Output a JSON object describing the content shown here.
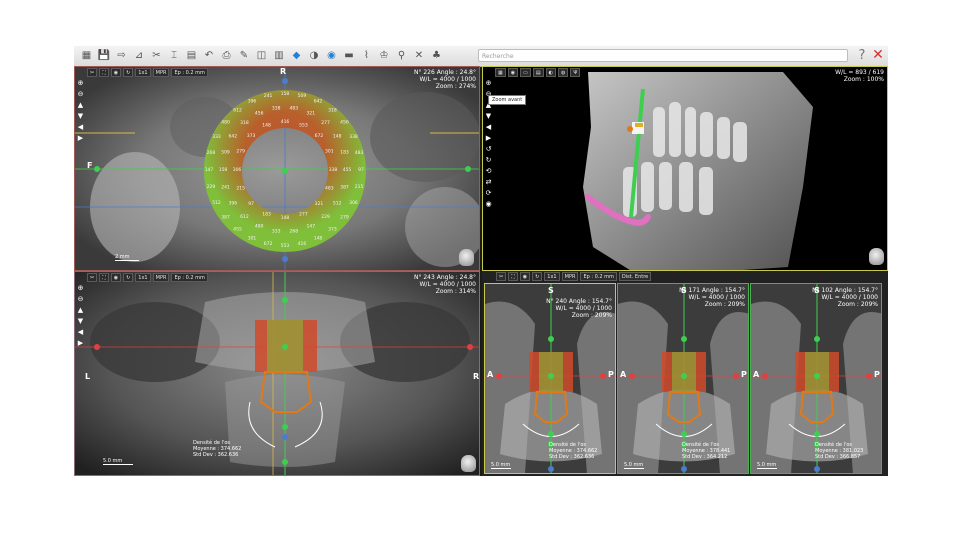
{
  "colors": {
    "toolbar_bg": "#e8e8e8",
    "close_red": "#d93030",
    "axial_border": "#a05a55",
    "coronal_border": "#8a6a7a",
    "volume_border": "#c8c84a",
    "slice_border_yellow": "#c8c84a",
    "slice_border_green": "#4caf50",
    "guide_green": "#3fcf50",
    "guide_blue": "#4c7bd0",
    "implant_orange": "#e07a18",
    "nerve_pink": "#e070c0",
    "density_high": "#d84a2a",
    "density_low": "#8ac43a"
  },
  "toolbar": {
    "icons": [
      "layout-icon",
      "save-icon",
      "export-icon",
      "measure-icon",
      "tools-icon",
      "implant-icon",
      "report-icon",
      "undo-icon",
      "print-icon",
      "annotation-icon",
      "screenshot-icon",
      "clipboard-icon",
      "volume-3d-icon",
      "contrast-icon",
      "render-3d-icon",
      "label-icon",
      "nerve-icon",
      "crown-icon",
      "implant-library-icon",
      "cut-icon",
      "tree-icon"
    ],
    "search_placeholder": "Recherche",
    "help": "?",
    "close": "✕"
  },
  "view_axial": {
    "orient_top": "R",
    "orient_left": "F",
    "toolbar": [
      "1x1",
      "MPR",
      "Ep : 0.2 mm"
    ],
    "info": [
      "N° 226 Angle : 24.8°",
      "W/L = 4000 / 1000",
      "Zoom : 274%"
    ],
    "scale": "2 mm"
  },
  "view_volume": {
    "info": [
      "W/L = 893 / 619",
      "Zoom : 100%"
    ],
    "tooltip": "Zoom avant"
  },
  "view_coronal": {
    "toolbar": [
      "1x1",
      "MPR",
      "Ep : 0.2 mm"
    ],
    "info": [
      "N° 243 Angle : 24.8°",
      "W/L = 4000 / 1000",
      "Zoom : 314%"
    ],
    "orient_left": "L",
    "orient_right": "R",
    "stats": [
      "Densité de l'os",
      "Moyenne : 374.662",
      "Std Dev : 362.636"
    ],
    "scale": "5.0 mm"
  },
  "view_slice1": {
    "toolbar": [
      "1x1",
      "MPR",
      "Ep : 0.2 mm",
      "Dist. Entre"
    ],
    "info": [
      "N° 240 Angle : 154.7°",
      "W/L = 4000 / 1000",
      "Zoom : 209%"
    ],
    "orient_top": "S",
    "orient_left": "A",
    "orient_right": "P",
    "stats": [
      "Densité de l'os",
      "Moyenne : 374.662",
      "Std Dev : 362.636"
    ],
    "scale": "5.0 mm"
  },
  "view_slice2": {
    "info": [
      "N° 171 Angle : 154.7°",
      "W/L = 4000 / 1000",
      "Zoom : 209%"
    ],
    "orient_top": "S",
    "orient_left": "A",
    "orient_right": "P",
    "stats": [
      "Densité de l'os",
      "Moyenne : 378.441",
      "Std Dev : 364.212"
    ],
    "scale": "5.0 mm"
  },
  "view_slice3": {
    "info": [
      "N° 102 Angle : 154.7°",
      "W/L = 4000 / 1000",
      "Zoom : 209%"
    ],
    "orient_top": "S",
    "orient_left": "A",
    "orient_right": "P",
    "stats": [
      "Densité de l'os",
      "Moyenne : 381.023",
      "Std Dev : 366.857"
    ],
    "scale": "5.0 mm"
  },
  "view_tools": [
    "zoom-in-icon",
    "zoom-out-icon",
    "move-up-icon",
    "move-down-icon",
    "move-left-icon",
    "move-right-icon"
  ],
  "volume_tools": [
    "zoom-in-icon",
    "zoom-out-icon",
    "move-up-icon",
    "move-down-icon",
    "move-left-icon",
    "move-right-icon",
    "rotate-left-icon",
    "rotate-right-icon",
    "reset-rotate-icon",
    "flip-icon",
    "refresh-icon",
    "camera-icon"
  ]
}
